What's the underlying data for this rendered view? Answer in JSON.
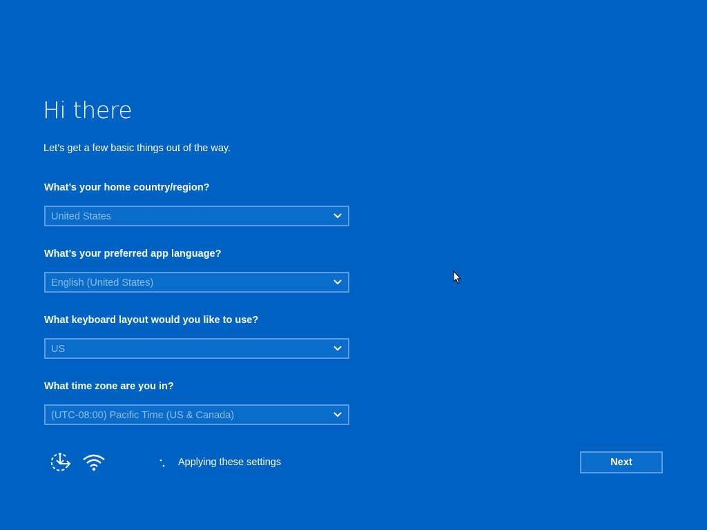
{
  "page": {
    "title": "Hi there",
    "subtitle": "Let’s get a few basic things out of the way."
  },
  "fields": [
    {
      "label": "What’s your home country/region?",
      "value": "United States"
    },
    {
      "label": "What’s your preferred app language?",
      "value": "English (United States)"
    },
    {
      "label": "What keyboard layout would you like to use?",
      "value": "US"
    },
    {
      "label": "What time zone are you in?",
      "value": "(UTC-08:00) Pacific Time (US & Canada)"
    }
  ],
  "footer": {
    "icons": [
      "ease-of-access-icon",
      "wifi-icon"
    ],
    "status_text": "Applying these settings",
    "next_label": "Next"
  },
  "colors": {
    "background": "#0063c4",
    "field_border": "#5d9ee0",
    "field_value_text": "#8fbde9",
    "text": "#ffffff"
  }
}
